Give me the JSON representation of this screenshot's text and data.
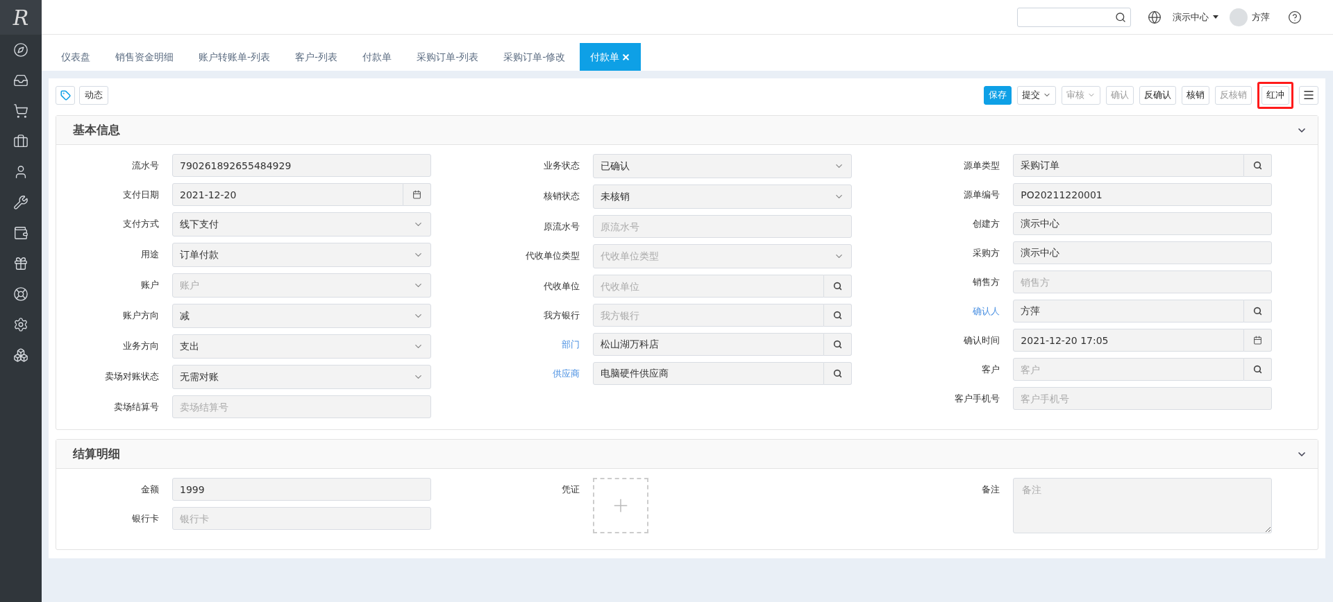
{
  "logo": "R",
  "header": {
    "org": "演示中心",
    "user": "方萍"
  },
  "tabs": [
    {
      "label": "仪表盘",
      "selected": false
    },
    {
      "label": "销售资金明细",
      "selected": false
    },
    {
      "label": "账户转账单-列表",
      "selected": false
    },
    {
      "label": "客户-列表",
      "selected": false
    },
    {
      "label": "付款单",
      "selected": false
    },
    {
      "label": "采购订单-列表",
      "selected": false
    },
    {
      "label": "采购订单-修改",
      "selected": false
    },
    {
      "label": "付款单",
      "selected": true
    }
  ],
  "toolbar": {
    "left": [
      {
        "kind": "icon"
      },
      {
        "kind": "text",
        "label": "动态"
      }
    ],
    "right": [
      {
        "label": "保存",
        "kind": "primary",
        "disabled": false,
        "highlighted": false
      },
      {
        "label": "提交",
        "kind": "dropdown",
        "disabled": false,
        "highlighted": false
      },
      {
        "label": "审核",
        "kind": "dropdown",
        "disabled": true,
        "highlighted": false
      },
      {
        "label": "确认",
        "kind": "default",
        "disabled": true,
        "highlighted": false
      },
      {
        "label": "反确认",
        "kind": "default",
        "disabled": false,
        "highlighted": false
      },
      {
        "label": "核销",
        "kind": "default",
        "disabled": false,
        "highlighted": false
      },
      {
        "label": "反核销",
        "kind": "default",
        "disabled": true,
        "highlighted": false
      },
      {
        "label": "红冲",
        "kind": "default",
        "disabled": false,
        "highlighted": true
      }
    ]
  },
  "sections": [
    {
      "title": "基本信息",
      "expanded": true,
      "columns": [
        [
          {
            "label": "流水号",
            "link": false,
            "kind": "text",
            "value": "790261892655484929"
          },
          {
            "label": "支付日期",
            "link": false,
            "kind": "date",
            "value": "2021-12-20"
          },
          {
            "label": "支付方式",
            "link": false,
            "kind": "select",
            "value": "线下支付"
          },
          {
            "label": "用途",
            "link": false,
            "kind": "select",
            "value": "订单付款"
          },
          {
            "label": "账户",
            "link": false,
            "kind": "select",
            "placeholder": "账户"
          },
          {
            "label": "账户方向",
            "link": false,
            "kind": "select",
            "value": "减"
          },
          {
            "label": "业务方向",
            "link": false,
            "kind": "select",
            "value": "支出"
          },
          {
            "label": "卖场对账状态",
            "link": false,
            "kind": "select",
            "value": "无需对账"
          },
          {
            "label": "卖场结算号",
            "link": false,
            "kind": "text",
            "placeholder": "卖场结算号"
          }
        ],
        [
          {
            "label": "业务状态",
            "link": false,
            "kind": "select",
            "value": "已确认"
          },
          {
            "label": "核销状态",
            "link": false,
            "kind": "select",
            "value": "未核销"
          },
          {
            "label": "原流水号",
            "link": false,
            "kind": "text",
            "placeholder": "原流水号"
          },
          {
            "label": "代收单位类型",
            "link": false,
            "kind": "select",
            "placeholder": "代收单位类型"
          },
          {
            "label": "代收单位",
            "link": false,
            "kind": "search",
            "placeholder": "代收单位"
          },
          {
            "label": "我方银行",
            "link": false,
            "kind": "search",
            "placeholder": "我方银行"
          },
          {
            "label": "部门",
            "link": true,
            "kind": "search",
            "value": "松山湖万科店"
          },
          {
            "label": "供应商",
            "link": true,
            "kind": "search",
            "value": "电脑硬件供应商"
          }
        ],
        [
          {
            "label": "源单类型",
            "link": false,
            "kind": "search",
            "value": "采购订单"
          },
          {
            "label": "源单编号",
            "link": false,
            "kind": "text",
            "value": "PO20211220001"
          },
          {
            "label": "创建方",
            "link": false,
            "kind": "text",
            "value": "演示中心"
          },
          {
            "label": "采购方",
            "link": false,
            "kind": "text",
            "value": "演示中心"
          },
          {
            "label": "销售方",
            "link": false,
            "kind": "text",
            "placeholder": "销售方"
          },
          {
            "label": "确认人",
            "link": true,
            "kind": "search",
            "value": "方萍"
          },
          {
            "label": "确认时间",
            "link": false,
            "kind": "date",
            "value": "2021-12-20 17:05"
          },
          {
            "label": "客户",
            "link": false,
            "kind": "search",
            "placeholder": "客户"
          },
          {
            "label": "客户手机号",
            "link": false,
            "kind": "text",
            "placeholder": "客户手机号"
          }
        ]
      ]
    },
    {
      "title": "结算明细",
      "expanded": true,
      "columns": [
        [
          {
            "label": "金额",
            "link": false,
            "kind": "text",
            "value": "1999"
          },
          {
            "label": "银行卡",
            "link": false,
            "kind": "text",
            "placeholder": "银行卡"
          }
        ],
        [
          {
            "label": "凭证",
            "link": false,
            "kind": "upload"
          }
        ],
        [
          {
            "label": "备注",
            "link": false,
            "kind": "textarea",
            "placeholder": "备注"
          }
        ]
      ]
    }
  ]
}
